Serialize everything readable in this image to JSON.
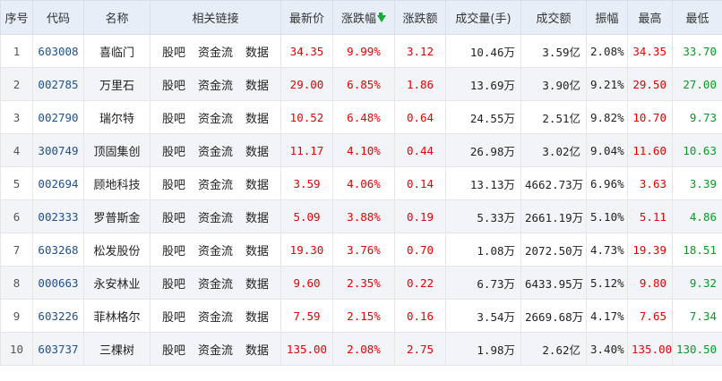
{
  "table": {
    "headers": {
      "index": "序号",
      "code": "代码",
      "name": "名称",
      "links": "相关链接",
      "price": "最新价",
      "change_pct": "涨跌幅",
      "change_amt": "涨跌额",
      "volume": "成交量(手)",
      "turnover": "成交额",
      "amplitude": "振幅",
      "high": "最高",
      "low": "最低"
    },
    "link_labels": {
      "guba": "股吧",
      "fund_flow": "资金流",
      "data": "数据"
    },
    "sort_icon": "sort-down-arrow-icon",
    "colors": {
      "up": "#e50000",
      "down": "#0a9a23",
      "header_bg": "#e7eef8",
      "alt_row_bg": "#f2f4f8"
    },
    "rows": [
      {
        "index": "1",
        "code": "603008",
        "name": "喜临门",
        "price": "34.35",
        "change_pct": "9.99%",
        "change_amt": "3.12",
        "volume": "10.46万",
        "turnover": "3.59亿",
        "amplitude": "2.08%",
        "high": "34.35",
        "low": "33.70"
      },
      {
        "index": "2",
        "code": "002785",
        "name": "万里石",
        "price": "29.00",
        "change_pct": "6.85%",
        "change_amt": "1.86",
        "volume": "13.69万",
        "turnover": "3.90亿",
        "amplitude": "9.21%",
        "high": "29.50",
        "low": "27.00"
      },
      {
        "index": "3",
        "code": "002790",
        "name": "瑞尔特",
        "price": "10.52",
        "change_pct": "6.48%",
        "change_amt": "0.64",
        "volume": "24.55万",
        "turnover": "2.51亿",
        "amplitude": "9.82%",
        "high": "10.70",
        "low": "9.73"
      },
      {
        "index": "4",
        "code": "300749",
        "name": "顶固集创",
        "price": "11.17",
        "change_pct": "4.10%",
        "change_amt": "0.44",
        "volume": "26.98万",
        "turnover": "3.02亿",
        "amplitude": "9.04%",
        "high": "11.60",
        "low": "10.63"
      },
      {
        "index": "5",
        "code": "002694",
        "name": "顾地科技",
        "price": "3.59",
        "change_pct": "4.06%",
        "change_amt": "0.14",
        "volume": "13.13万",
        "turnover": "4662.73万",
        "amplitude": "6.96%",
        "high": "3.63",
        "low": "3.39"
      },
      {
        "index": "6",
        "code": "002333",
        "name": "罗普斯金",
        "price": "5.09",
        "change_pct": "3.88%",
        "change_amt": "0.19",
        "volume": "5.33万",
        "turnover": "2661.19万",
        "amplitude": "5.10%",
        "high": "5.11",
        "low": "4.86"
      },
      {
        "index": "7",
        "code": "603268",
        "name": "松发股份",
        "price": "19.30",
        "change_pct": "3.76%",
        "change_amt": "0.70",
        "volume": "1.08万",
        "turnover": "2072.50万",
        "amplitude": "4.73%",
        "high": "19.39",
        "low": "18.51"
      },
      {
        "index": "8",
        "code": "000663",
        "name": "永安林业",
        "price": "9.60",
        "change_pct": "2.35%",
        "change_amt": "0.22",
        "volume": "6.73万",
        "turnover": "6433.95万",
        "amplitude": "5.12%",
        "high": "9.80",
        "low": "9.32"
      },
      {
        "index": "9",
        "code": "603226",
        "name": "菲林格尔",
        "price": "7.59",
        "change_pct": "2.15%",
        "change_amt": "0.16",
        "volume": "3.54万",
        "turnover": "2669.68万",
        "amplitude": "4.17%",
        "high": "7.65",
        "low": "7.34"
      },
      {
        "index": "10",
        "code": "603737",
        "name": "三棵树",
        "price": "135.00",
        "change_pct": "2.08%",
        "change_amt": "2.75",
        "volume": "1.98万",
        "turnover": "2.62亿",
        "amplitude": "3.40%",
        "high": "135.00",
        "low": "130.50"
      }
    ]
  }
}
